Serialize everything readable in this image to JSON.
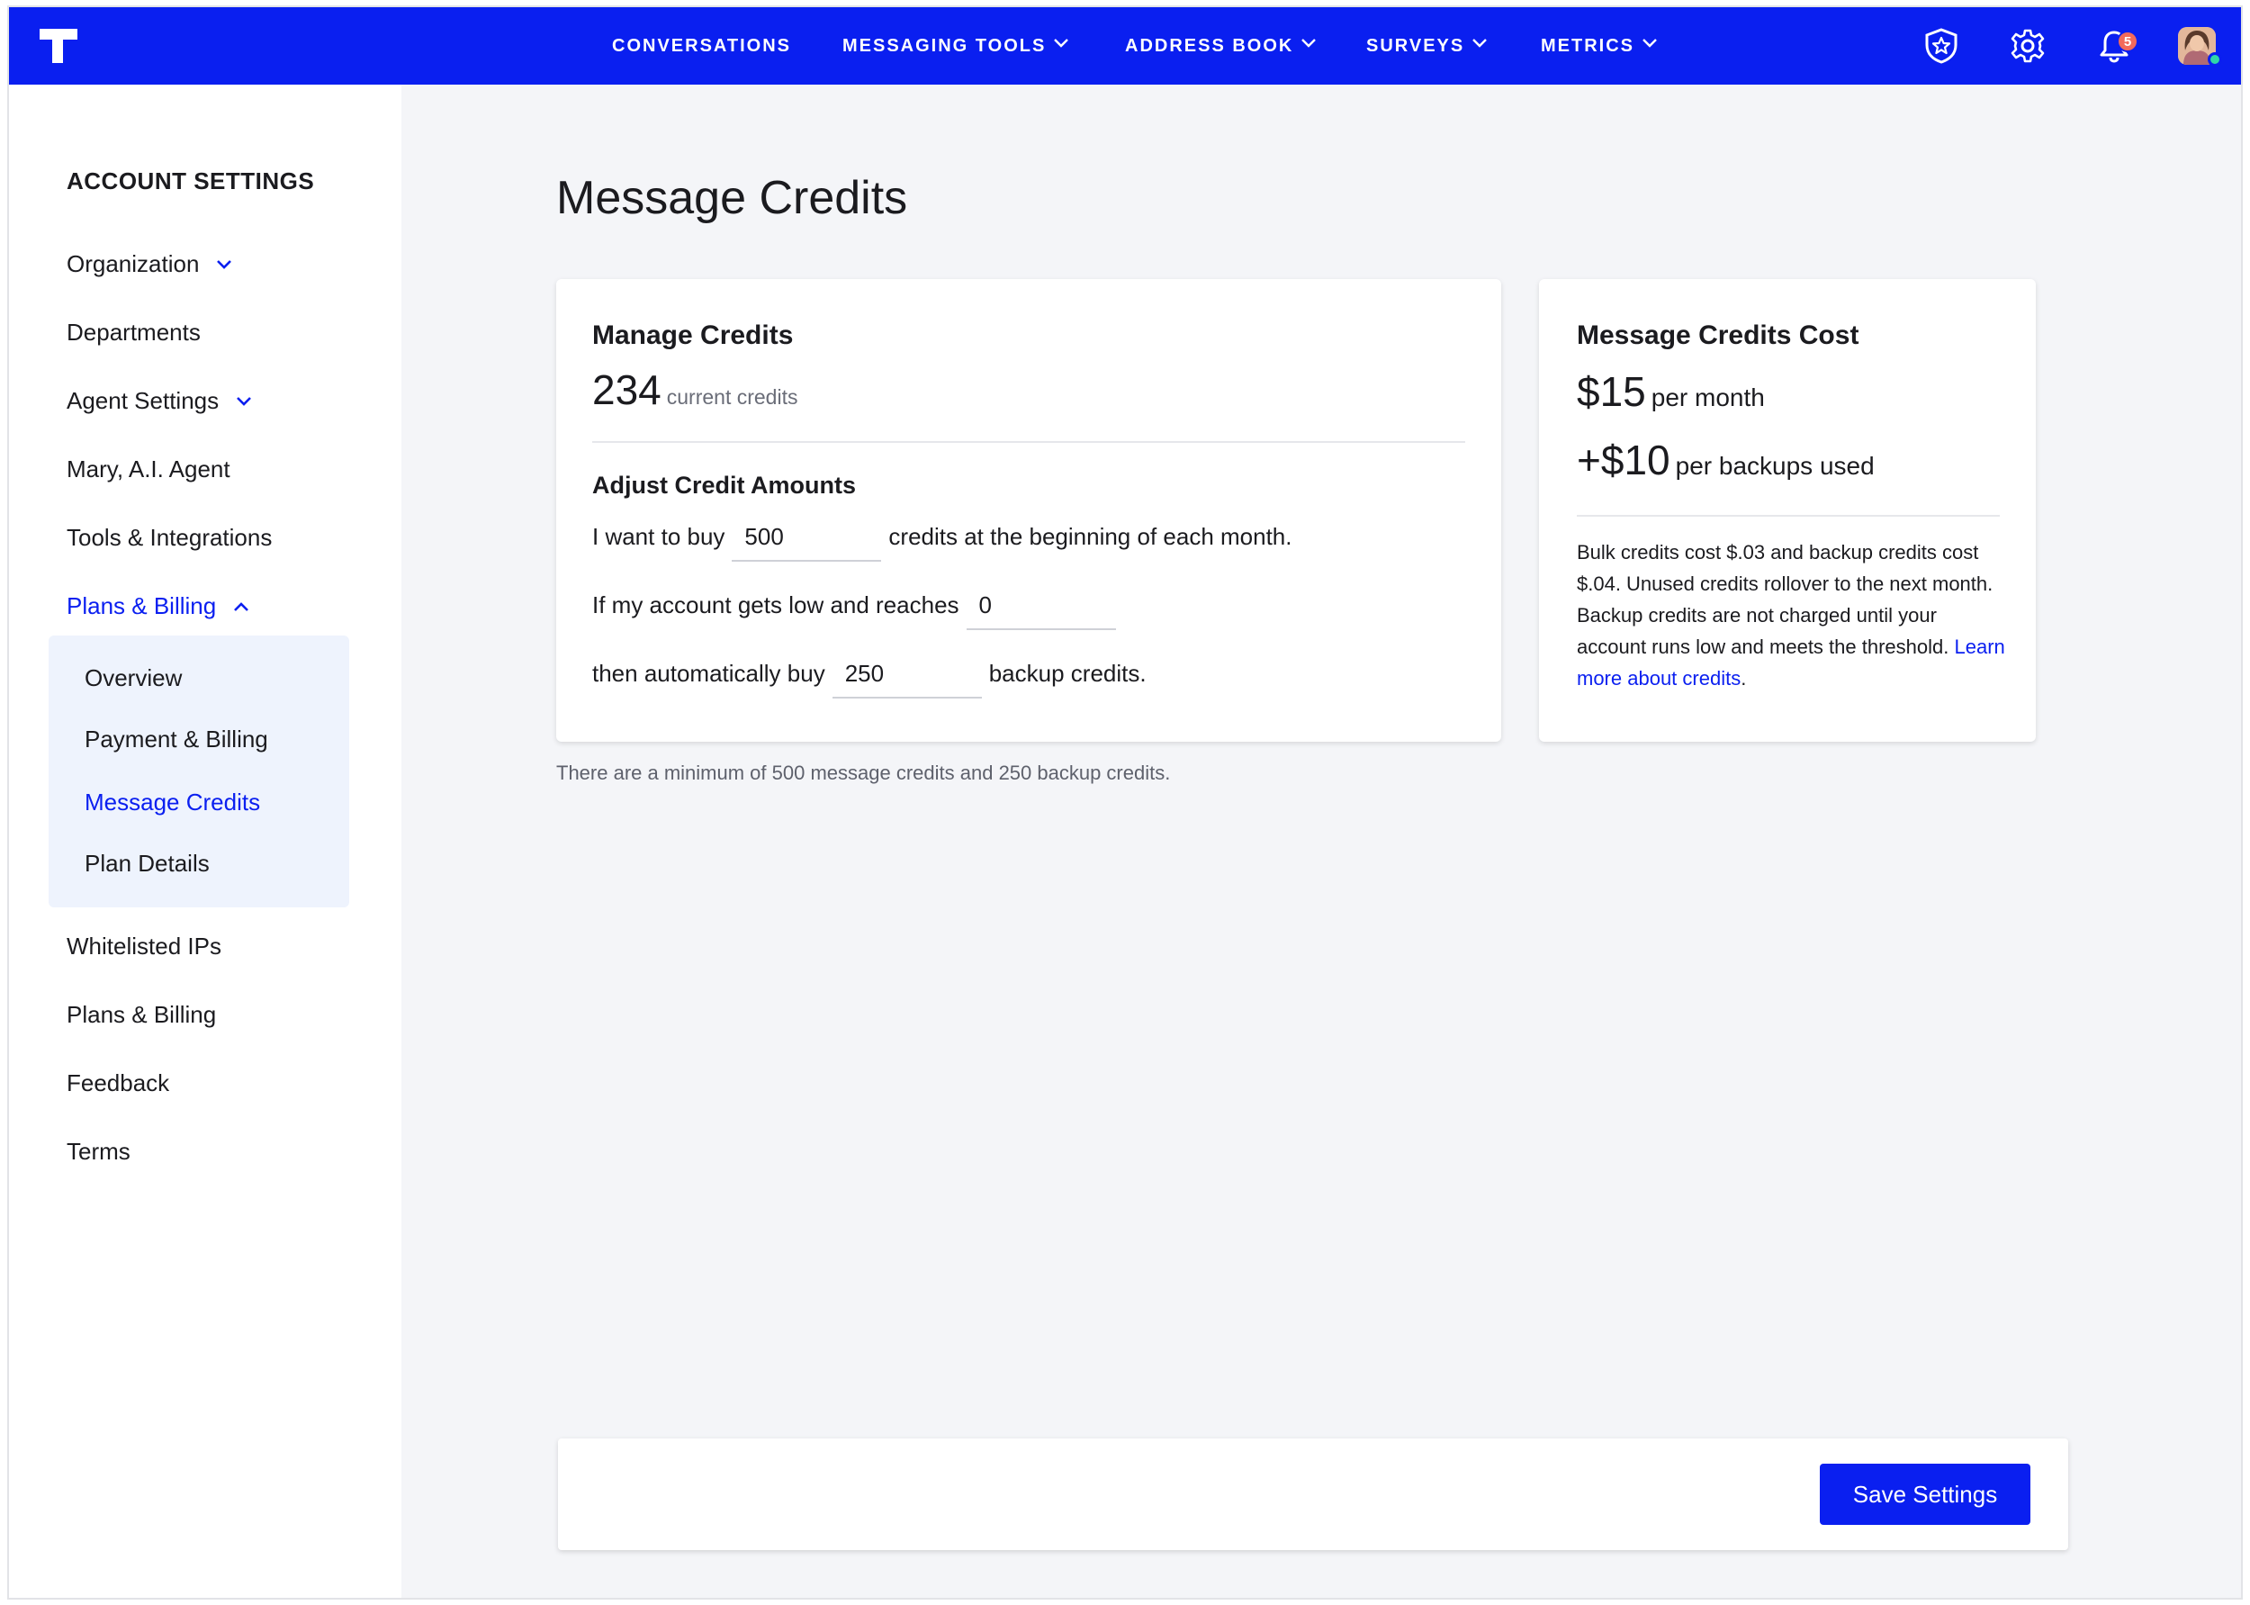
{
  "topbar": {
    "nav": [
      {
        "label": "CONVERSATIONS",
        "has_menu": false
      },
      {
        "label": "MESSAGING TOOLS",
        "has_menu": true
      },
      {
        "label": "ADDRESS BOOK",
        "has_menu": true
      },
      {
        "label": "SURVEYS",
        "has_menu": true
      },
      {
        "label": "METRICS",
        "has_menu": true
      }
    ],
    "icons": [
      "shield-star-icon",
      "gear-icon",
      "bell-icon"
    ],
    "notification_count": "5",
    "brand_color": "#0a1ff0"
  },
  "sidebar": {
    "title": "ACCOUNT SETTINGS",
    "items": [
      {
        "label": "Organization"
      },
      {
        "label": "Departments"
      },
      {
        "label": "Agent Settings"
      },
      {
        "label": "Mary, A.I. Agent"
      },
      {
        "label": "Tools & Integrations"
      },
      {
        "label": "Plans & Billing"
      },
      {
        "label": "Whitelisted IPs"
      },
      {
        "label": "Plans & Billing"
      },
      {
        "label": "Feedback"
      },
      {
        "label": "Terms"
      }
    ],
    "submenu": [
      {
        "label": "Overview"
      },
      {
        "label": "Payment & Billing"
      },
      {
        "label": "Message Credits"
      },
      {
        "label": "Plan Details"
      }
    ]
  },
  "main": {
    "title": "Message Credits",
    "manage": {
      "heading": "Manage Credits",
      "current_credits": "234",
      "current_credits_label": "current credits",
      "adjust_heading": "Adjust Credit Amounts",
      "row1_prefix": "I want to buy",
      "row1_value": "500",
      "row1_suffix": "credits at the beginning of each month.",
      "row2_prefix": "If my account gets low and reaches",
      "row2_value": "0",
      "row3_prefix": "then automatically buy",
      "row3_value": "250",
      "row3_suffix": "backup credits."
    },
    "cost": {
      "heading": "Message Credits Cost",
      "price1": "$15",
      "price1_label": "per month",
      "price2": "+$10",
      "price2_label": "per backups used",
      "description": "Bulk credits cost $.03 and backup credits cost $.04. Unused credits rollover to the next month. Backup credits are not charged until your account runs low and meets the threshold.",
      "link": "Learn more about credits",
      "link_after": "."
    },
    "hint": "There are a minimum of 500 message credits and 250 backup credits.",
    "save_label": "Save Settings"
  }
}
